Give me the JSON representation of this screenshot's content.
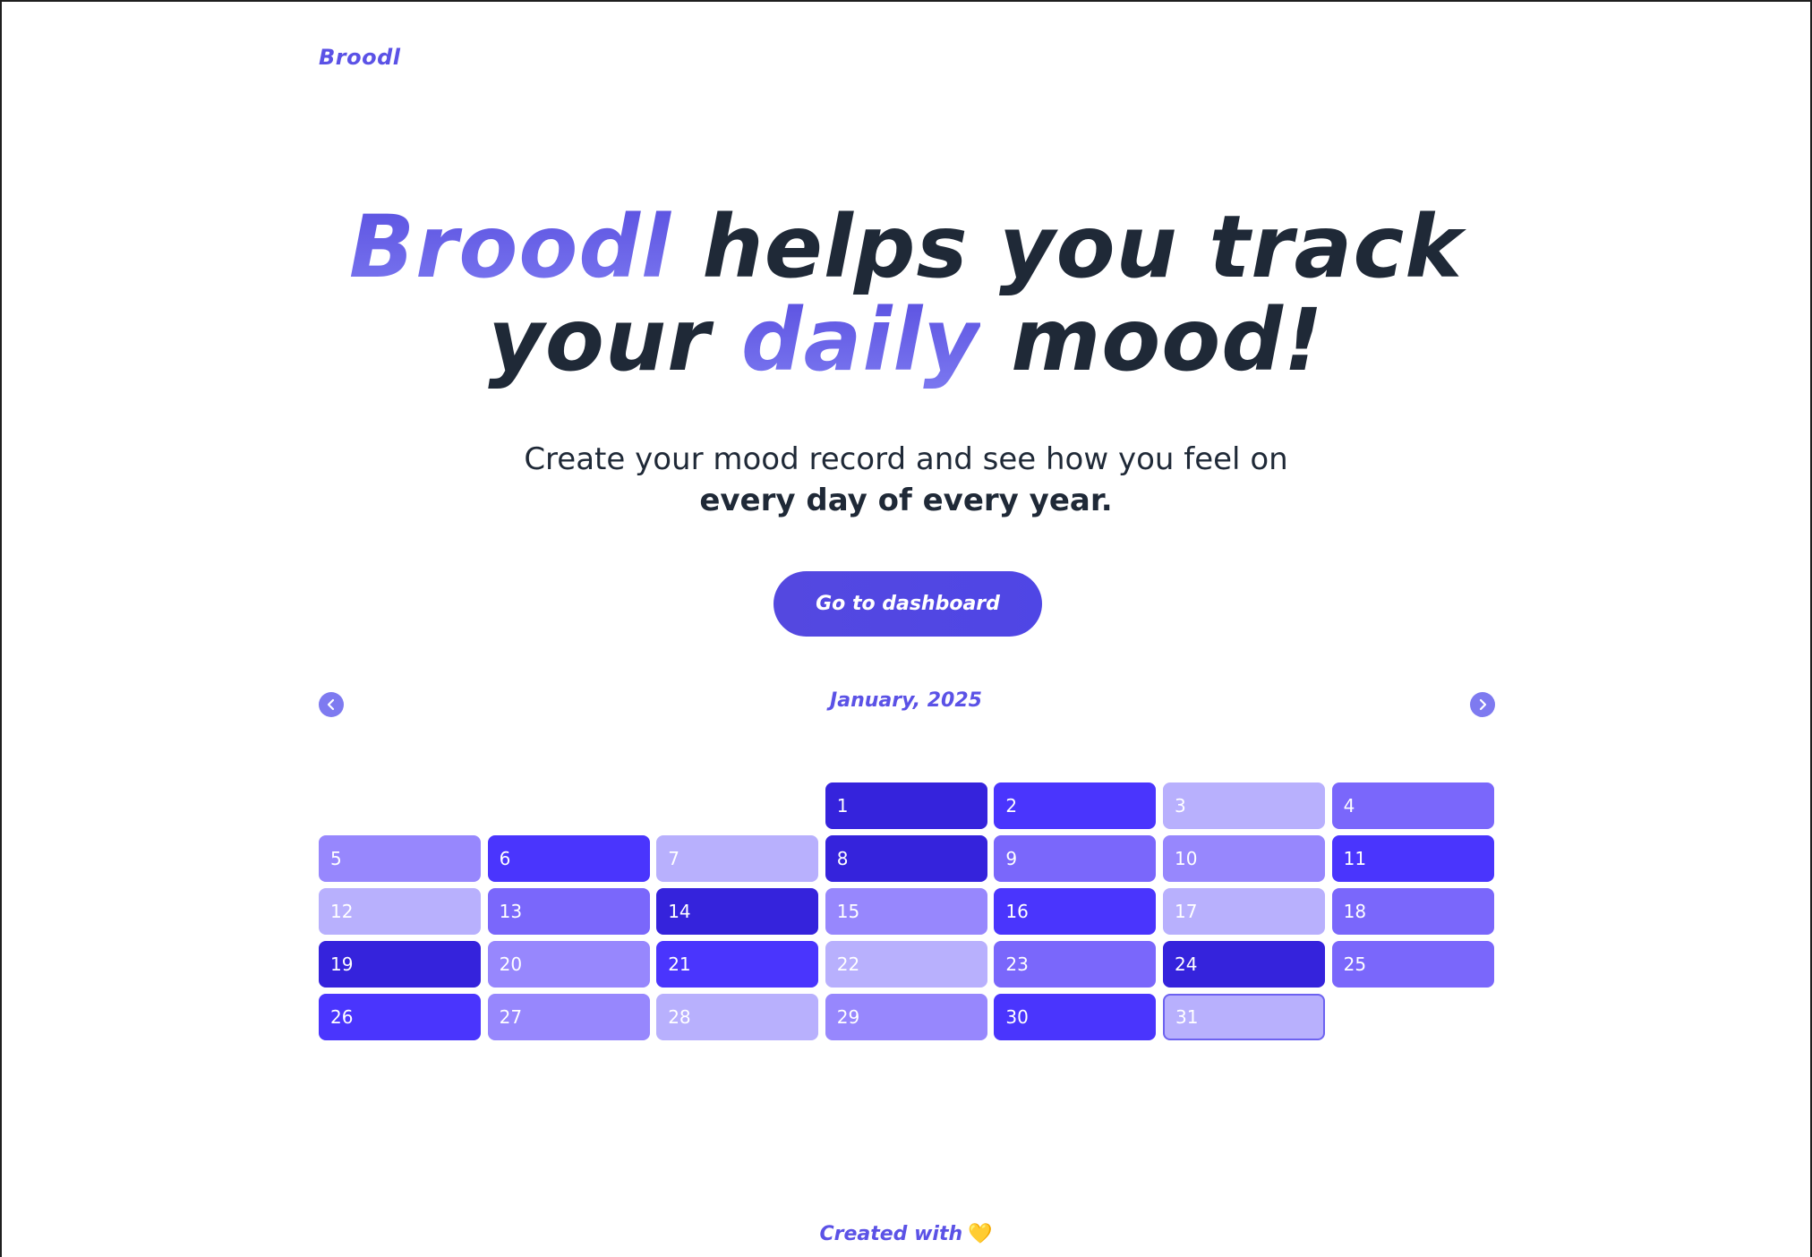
{
  "header": {
    "brand": "Broodl"
  },
  "hero": {
    "title_brand": "Broodl",
    "title_part1": " helps you track",
    "title_part2": "your ",
    "title_highlight": "daily",
    "title_part3": " mood!"
  },
  "subtitle": {
    "line1": "Create your mood record and see how you feel on",
    "line2": "every day of every year."
  },
  "cta": {
    "label": "Go to dashboard"
  },
  "calendar": {
    "month_label": "January, 2025",
    "prev_icon": "chevron-left-icon",
    "next_icon": "chevron-right-icon",
    "first_weekday_index": 3,
    "colors": {
      "level1": "#b8b0fd",
      "level2": "#9787fd",
      "level3": "#7a67fb",
      "level4": "#4a35fd",
      "level5": "#3523dc"
    },
    "days": [
      {
        "day": "1",
        "level": 5
      },
      {
        "day": "2",
        "level": 4
      },
      {
        "day": "3",
        "level": 1
      },
      {
        "day": "4",
        "level": 3
      },
      {
        "day": "5",
        "level": 2
      },
      {
        "day": "6",
        "level": 4
      },
      {
        "day": "7",
        "level": 1
      },
      {
        "day": "8",
        "level": 5
      },
      {
        "day": "9",
        "level": 3
      },
      {
        "day": "10",
        "level": 2
      },
      {
        "day": "11",
        "level": 4
      },
      {
        "day": "12",
        "level": 1
      },
      {
        "day": "13",
        "level": 3
      },
      {
        "day": "14",
        "level": 5
      },
      {
        "day": "15",
        "level": 2
      },
      {
        "day": "16",
        "level": 4
      },
      {
        "day": "17",
        "level": 1
      },
      {
        "day": "18",
        "level": 3
      },
      {
        "day": "19",
        "level": 5
      },
      {
        "day": "20",
        "level": 2
      },
      {
        "day": "21",
        "level": 4
      },
      {
        "day": "22",
        "level": 1
      },
      {
        "day": "23",
        "level": 3
      },
      {
        "day": "24",
        "level": 5
      },
      {
        "day": "25",
        "level": 3
      },
      {
        "day": "26",
        "level": 4
      },
      {
        "day": "27",
        "level": 2
      },
      {
        "day": "28",
        "level": 1
      },
      {
        "day": "29",
        "level": 2
      },
      {
        "day": "30",
        "level": 4
      },
      {
        "day": "31",
        "level": 1
      }
    ],
    "today": "31"
  },
  "footer": {
    "text": "Created with",
    "heart": "💛"
  }
}
